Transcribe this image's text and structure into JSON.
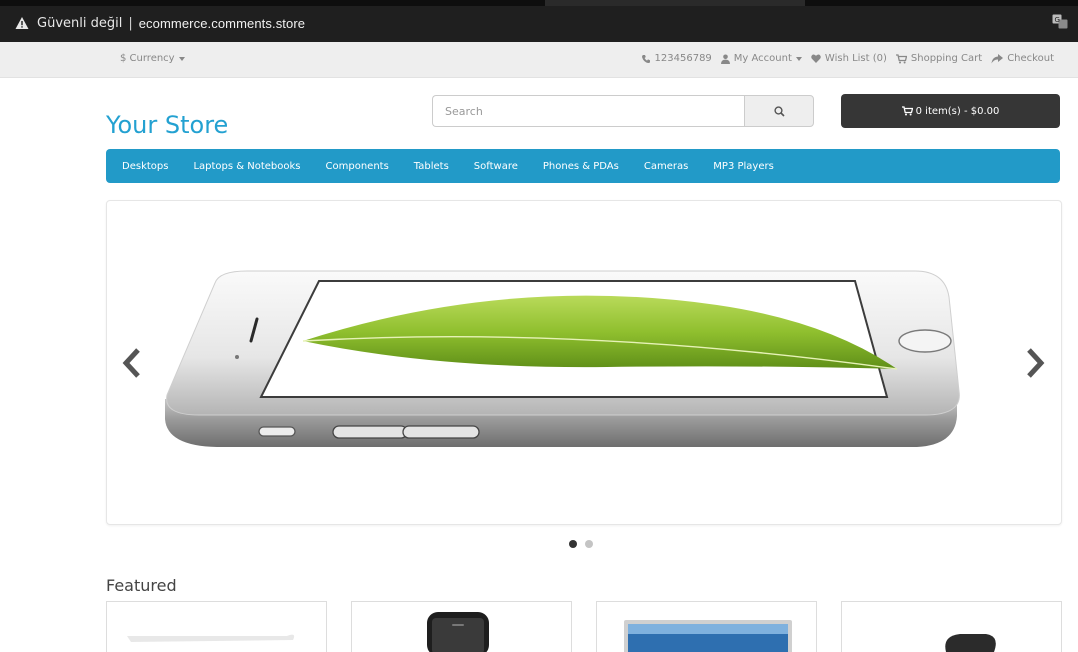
{
  "browser": {
    "security_label": "Güvenli değil",
    "separator": "|",
    "url": "ecommerce.comments.store"
  },
  "topnav": {
    "currency_label": "$ Currency",
    "phone": "123456789",
    "my_account": "My Account",
    "wish_list": "Wish List (0)",
    "shopping_cart": "Shopping Cart",
    "checkout": "Checkout"
  },
  "header": {
    "logo": "Your Store",
    "search_placeholder": "Search",
    "cart_label": "0 item(s) - $0.00"
  },
  "menu": {
    "items": [
      "Desktops",
      "Laptops & Notebooks",
      "Components",
      "Tablets",
      "Software",
      "Phones & PDAs",
      "Cameras",
      "MP3 Players"
    ]
  },
  "slideshow": {
    "slide_count": 2,
    "active_slide": 1
  },
  "featured": {
    "title": "Featured",
    "product_count": 4
  },
  "colors": {
    "accent": "#23a1d1",
    "menu_bg": "#229ac8",
    "cart_bg": "#363636",
    "browser_bar": "#1f1f1f"
  }
}
